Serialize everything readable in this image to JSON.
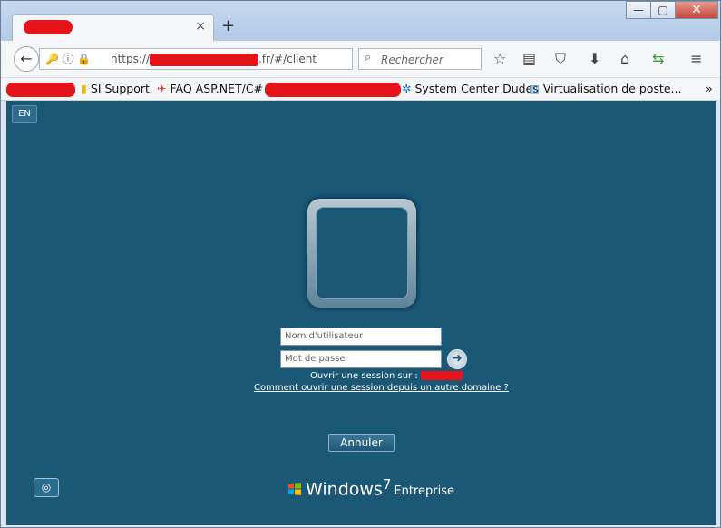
{
  "window": {
    "minimize": "—",
    "maximize": "▢",
    "close": "✕"
  },
  "tab": {
    "title": "",
    "close": "×",
    "new_tab": "+"
  },
  "nav": {
    "url_prefix": "https://",
    "url_suffix": ".fr/#/client",
    "search_placeholder": "Rechercher",
    "icons": [
      "back-icon",
      "key-icon",
      "info-icon",
      "lock-icon",
      "reload-icon",
      "search-icon",
      "star-icon",
      "reader-icon",
      "pocket-icon",
      "download-icon",
      "home-icon",
      "sync-icon",
      "menu-icon"
    ]
  },
  "bookmarks": {
    "items": [
      {
        "label": "SI Support"
      },
      {
        "label": "FAQ ASP.NET/C#"
      },
      {
        "label": "System Center Dudes"
      },
      {
        "label": "Virtualisation de poste..."
      }
    ],
    "overflow": "»"
  },
  "login": {
    "lang": "EN",
    "username_placeholder": "Nom d'utilisateur",
    "password_placeholder": "Mot de passe",
    "session_label": "Ouvrir une session sur :",
    "domain_link": "Comment ouvrir une session depuis un autre domaine ?",
    "cancel": "Annuler"
  },
  "brand": {
    "name": "Windows",
    "version": "7",
    "edition": "Entreprise"
  },
  "colors": {
    "background": "#1a5876",
    "redaction": "#e5141b",
    "chrome": "#f5f6f7"
  }
}
